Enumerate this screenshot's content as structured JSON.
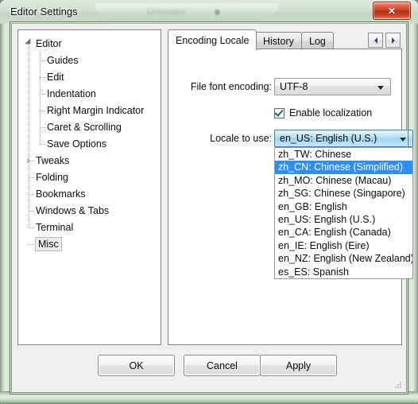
{
  "window": {
    "title": "Editor Settings",
    "close_label": "✕",
    "ghost_text": "Unknown",
    "accent_close": "#c93d22",
    "frame_color": "#7e987e"
  },
  "tree": {
    "name": "settings-tree",
    "items": [
      {
        "label": "Editor",
        "level": 0,
        "twisty": "expanded",
        "selected": false
      },
      {
        "label": "Guides",
        "level": 1,
        "twisty": "none",
        "selected": false
      },
      {
        "label": "Edit",
        "level": 1,
        "twisty": "none",
        "selected": false
      },
      {
        "label": "Indentation",
        "level": 1,
        "twisty": "none",
        "selected": false
      },
      {
        "label": "Right Margin Indicator",
        "level": 1,
        "twisty": "none",
        "selected": false
      },
      {
        "label": "Caret & Scrolling",
        "level": 1,
        "twisty": "none",
        "selected": false
      },
      {
        "label": "Save Options",
        "level": 1,
        "twisty": "none",
        "selected": false
      },
      {
        "label": "Tweaks",
        "level": 0,
        "twisty": "collapsed",
        "selected": false
      },
      {
        "label": "Folding",
        "level": 0,
        "twisty": "none",
        "selected": false
      },
      {
        "label": "Bookmarks",
        "level": 0,
        "twisty": "none",
        "selected": false
      },
      {
        "label": "Windows & Tabs",
        "level": 0,
        "twisty": "none",
        "selected": false
      },
      {
        "label": "Terminal",
        "level": 0,
        "twisty": "none",
        "selected": false
      },
      {
        "label": "Misc",
        "level": 0,
        "twisty": "none",
        "selected": true
      }
    ]
  },
  "tabs": {
    "items": [
      {
        "label": "Encoding Locale",
        "active": true
      },
      {
        "label": "History",
        "active": false
      },
      {
        "label": "Log",
        "active": false
      }
    ],
    "scroll_left_icon": "arrow-left-icon",
    "scroll_right_icon": "arrow-right-icon"
  },
  "form": {
    "encoding_label": "File font encoding:",
    "encoding_value": "UTF-8",
    "enable_localization_label": "Enable localization",
    "enable_localization_checked": true,
    "locale_label": "Locale to use:",
    "locale_value": "en_US: English (U.S.)",
    "locale_options": [
      "zh_TW: Chinese",
      "zh_CN: Chinese (Simplified)",
      "zh_MO: Chinese (Macau)",
      "zh_SG: Chinese (Singapore)",
      "en_GB: English",
      "en_US: English (U.S.)",
      "en_CA: English (Canada)",
      "en_IE: English (Eire)",
      "en_NZ: English (New Zealand)",
      "es_ES: Spanish"
    ],
    "locale_highlighted_index": 1,
    "highlight_color": "#2f8ef0"
  },
  "buttons": {
    "ok": "OK",
    "cancel": "Cancel",
    "apply": "Apply"
  }
}
